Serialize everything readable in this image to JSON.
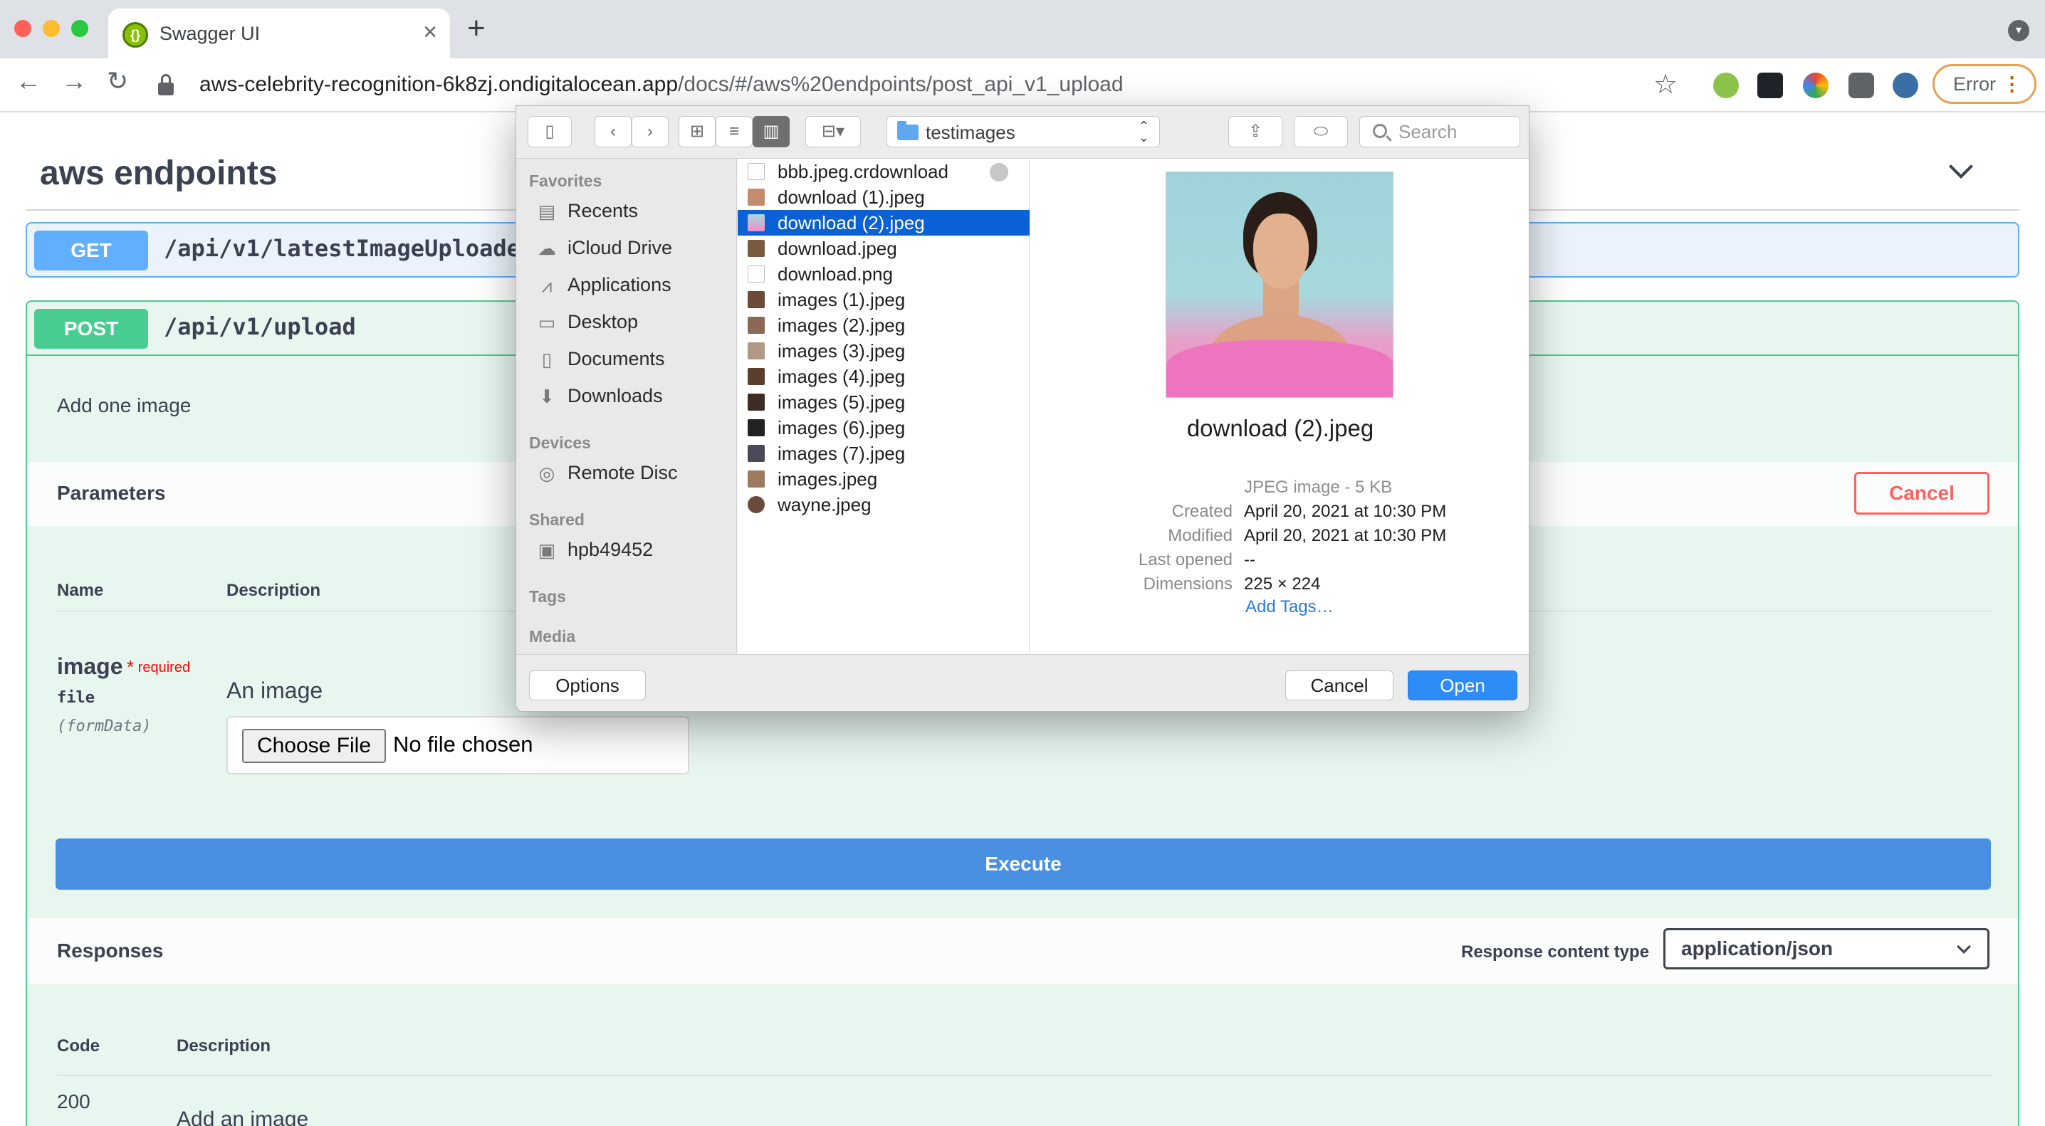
{
  "browser": {
    "tab_title": "Swagger UI",
    "tab_close": "×",
    "new_tab": "+",
    "url_host": "aws-celebrity-recognition-6k8zj.ondigitalocean.app",
    "url_path": "/docs/#/aws%20endpoints/post_api_v1_upload",
    "error_label": "Error",
    "back": "←",
    "forward": "→",
    "reload": "↻",
    "star": "☆",
    "colors": {
      "error_border": "#e8a14a"
    }
  },
  "swagger": {
    "section_title": "aws endpoints",
    "get_op": {
      "method": "GET",
      "path": "/api/v1/latestImageUploade"
    },
    "post_op": {
      "method": "POST",
      "path": "/api/v1/upload",
      "description": "Add one image",
      "parameters_title": "Parameters",
      "cancel_label": "Cancel",
      "columns": {
        "name": "Name",
        "description": "Description"
      },
      "param": {
        "name": "image",
        "required_star": "*",
        "required_label": "required",
        "type": "file",
        "in": "(formData)",
        "description": "An image",
        "choose_file": "Choose File",
        "no_file": "No file chosen"
      },
      "execute_label": "Execute",
      "responses_title": "Responses",
      "response_content_type_label": "Response content type",
      "response_content_type_value": "application/json",
      "response_columns": {
        "code": "Code",
        "description": "Description"
      },
      "response_row": {
        "code": "200",
        "description": "Add an image"
      }
    },
    "colors": {
      "get": "#61affe",
      "post": "#49cc90",
      "execute": "#4990e2",
      "cancel": "#ff6060"
    }
  },
  "dialog": {
    "location": "testimages",
    "search_placeholder": "Search",
    "sidebar": {
      "favorites_header": "Favorites",
      "favorites": [
        {
          "label": "Recents",
          "icon": "recents-icon"
        },
        {
          "label": "iCloud Drive",
          "icon": "cloud-icon"
        },
        {
          "label": "Applications",
          "icon": "applications-icon"
        },
        {
          "label": "Desktop",
          "icon": "desktop-icon"
        },
        {
          "label": "Documents",
          "icon": "documents-icon"
        },
        {
          "label": "Downloads",
          "icon": "downloads-icon"
        }
      ],
      "devices_header": "Devices",
      "devices": [
        {
          "label": "Remote Disc",
          "icon": "disc-icon"
        }
      ],
      "shared_header": "Shared",
      "shared": [
        {
          "label": "hpb49452",
          "icon": "computer-icon"
        }
      ],
      "tags_header": "Tags",
      "media_header": "Media"
    },
    "files": [
      {
        "name": "bbb.jpeg.crdownload",
        "selected": false
      },
      {
        "name": "download (1).jpeg",
        "selected": false
      },
      {
        "name": "download (2).jpeg",
        "selected": true
      },
      {
        "name": "download.jpeg",
        "selected": false
      },
      {
        "name": "download.png",
        "selected": false
      },
      {
        "name": "images (1).jpeg",
        "selected": false
      },
      {
        "name": "images (2).jpeg",
        "selected": false
      },
      {
        "name": "images (3).jpeg",
        "selected": false
      },
      {
        "name": "images (4).jpeg",
        "selected": false
      },
      {
        "name": "images (5).jpeg",
        "selected": false
      },
      {
        "name": "images (6).jpeg",
        "selected": false
      },
      {
        "name": "images (7).jpeg",
        "selected": false
      },
      {
        "name": "images.jpeg",
        "selected": false
      },
      {
        "name": "wayne.jpeg",
        "selected": false
      }
    ],
    "preview": {
      "file_name": "download (2).jpeg",
      "kind": "JPEG image - 5 KB",
      "meta": [
        {
          "label": "Created",
          "value": "April 20, 2021 at 10:30 PM"
        },
        {
          "label": "Modified",
          "value": "April 20, 2021 at 10:30 PM"
        },
        {
          "label": "Last opened",
          "value": "--"
        },
        {
          "label": "Dimensions",
          "value": "225 × 224"
        }
      ],
      "add_tags": "Add Tags…"
    },
    "buttons": {
      "options": "Options",
      "cancel": "Cancel",
      "open": "Open"
    },
    "colors": {
      "selection": "#0a60d6",
      "open_button": "#2d8cf6"
    }
  }
}
